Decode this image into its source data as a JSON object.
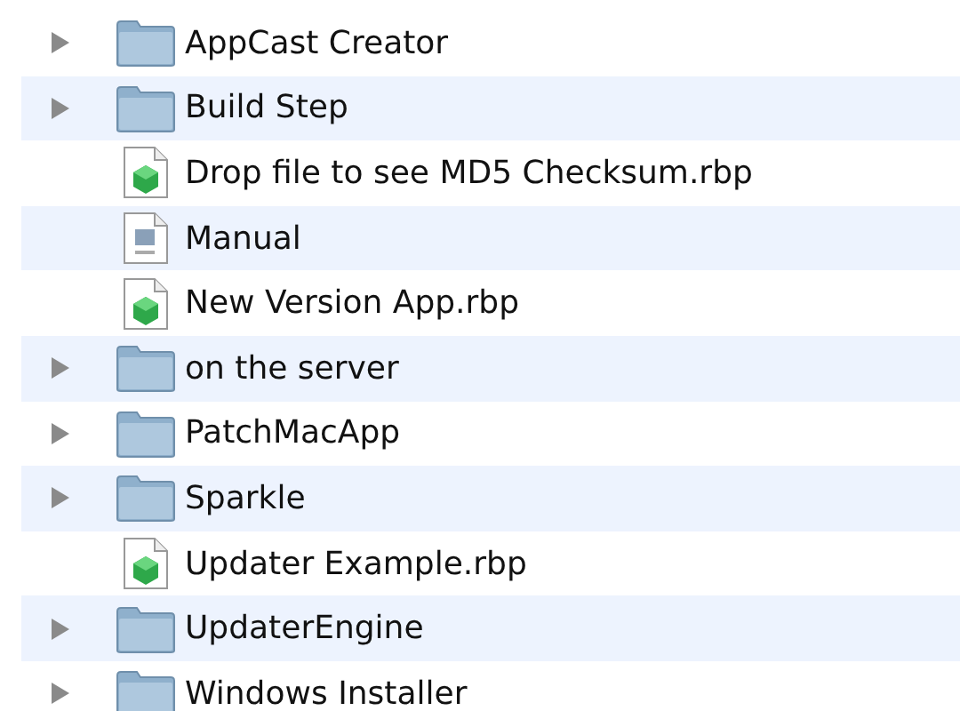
{
  "items": [
    {
      "name": "AppCast Creator",
      "kind": "folder",
      "expanded": false
    },
    {
      "name": "Build Step",
      "kind": "folder",
      "expanded": false
    },
    {
      "name": "Drop file to see MD5 Checksum.rbp",
      "kind": "project"
    },
    {
      "name": "Manual",
      "kind": "document"
    },
    {
      "name": "New Version App.rbp",
      "kind": "project"
    },
    {
      "name": "on the server",
      "kind": "folder",
      "expanded": false
    },
    {
      "name": "PatchMacApp",
      "kind": "folder",
      "expanded": false
    },
    {
      "name": "Sparkle",
      "kind": "folder",
      "expanded": false
    },
    {
      "name": "Updater Example.rbp",
      "kind": "project"
    },
    {
      "name": "UpdaterEngine",
      "kind": "folder",
      "expanded": false
    },
    {
      "name": "Windows Installer",
      "kind": "folder",
      "expanded": false
    }
  ]
}
